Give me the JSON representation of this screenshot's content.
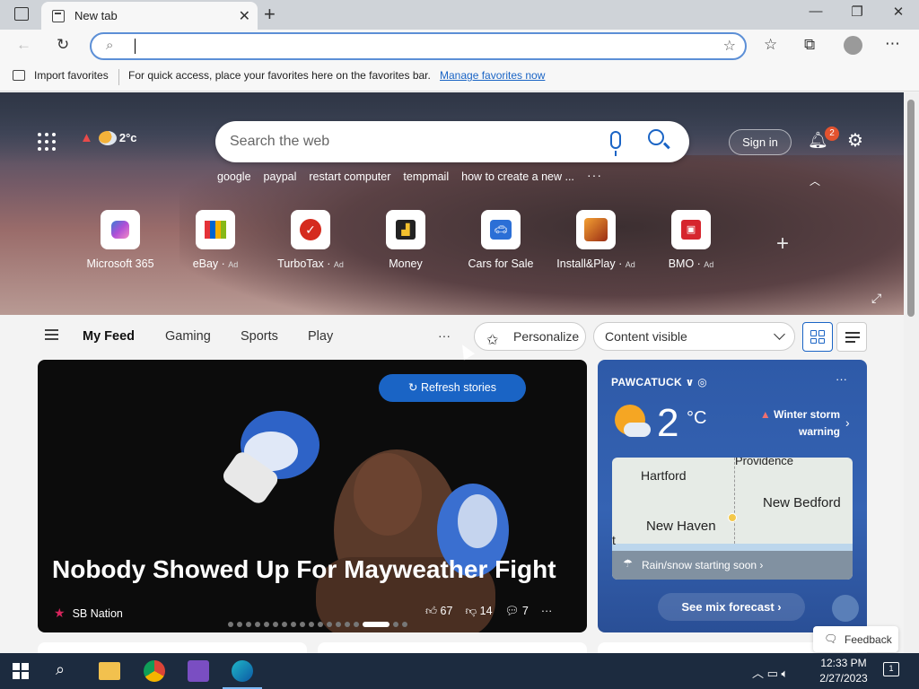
{
  "browser": {
    "tab_title": "New tab",
    "tab_close": "✕",
    "new_tab": "+",
    "favorites_bar": {
      "import_label": "Import favorites",
      "message": "For quick access, place your favorites here on the favorites bar.",
      "manage_link": "Manage favorites now"
    }
  },
  "hero": {
    "weather_temp": "2°c",
    "search_placeholder": "Search the web",
    "trending": [
      "google",
      "paypal",
      "restart computer",
      "tempmail",
      "how to create a new ..."
    ],
    "sign_in": "Sign in",
    "notification_count": "2",
    "tiles": [
      {
        "label": "Microsoft 365",
        "ad": ""
      },
      {
        "label": "eBay",
        "ad": "Ad"
      },
      {
        "label": "TurboTax",
        "ad": "Ad"
      },
      {
        "label": "Money",
        "ad": ""
      },
      {
        "label": "Cars for Sale",
        "ad": ""
      },
      {
        "label": "Install&Play",
        "ad": "Ad"
      },
      {
        "label": "BMO",
        "ad": "Ad"
      }
    ]
  },
  "feed": {
    "tabs": [
      "My Feed",
      "Gaming",
      "Sports",
      "Play"
    ],
    "more": "···",
    "personalize": "Personalize",
    "content_visibility": "Content visible"
  },
  "story": {
    "refresh_label": "Refresh stories",
    "headline": "Nobody Showed Up For Mayweather Fight",
    "source": "SB Nation",
    "likes": "67",
    "dislikes": "14",
    "comments": "7",
    "carousel_index": 15,
    "carousel_count": 18
  },
  "weather": {
    "location": "PAWCATUCK",
    "temperature": "2",
    "unit": "°C",
    "alert_line1": "Winter storm",
    "alert_line2": "warning",
    "map_cities": [
      "Hartford",
      "Providence",
      "New Bedford",
      "New Haven",
      "t"
    ],
    "rain_text": "Rain/snow starting soon",
    "forecast_button": "See mix forecast"
  },
  "feedback_label": "Feedback",
  "taskbar": {
    "time": "12:33 PM",
    "date": "2/27/2023",
    "notif_count": "1"
  }
}
